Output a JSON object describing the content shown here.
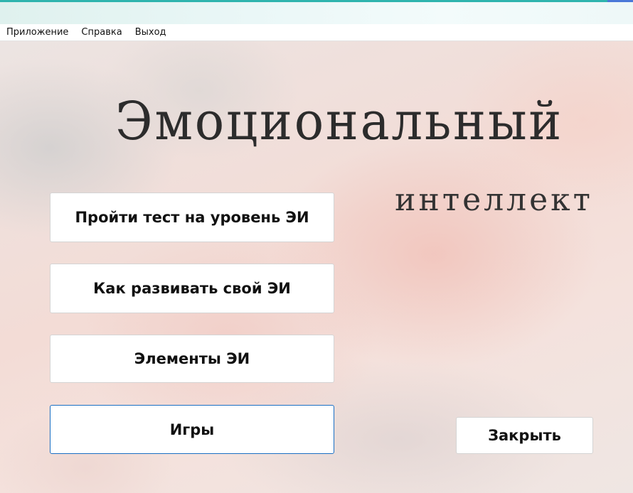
{
  "menu": {
    "items": [
      "Приложение",
      "Справка",
      "Выход"
    ]
  },
  "heading": {
    "title": "Эмоциональный",
    "subtitle": "интеллект"
  },
  "buttons": {
    "test": "Пройти тест на уровень ЭИ",
    "develop": "Как развивать свой ЭИ",
    "elements": "Элементы ЭИ",
    "games": "Игры",
    "close": "Закрыть"
  },
  "colors": {
    "focus_border": "#1a6fc4",
    "titlebar_accent": "#2fb4ae"
  }
}
